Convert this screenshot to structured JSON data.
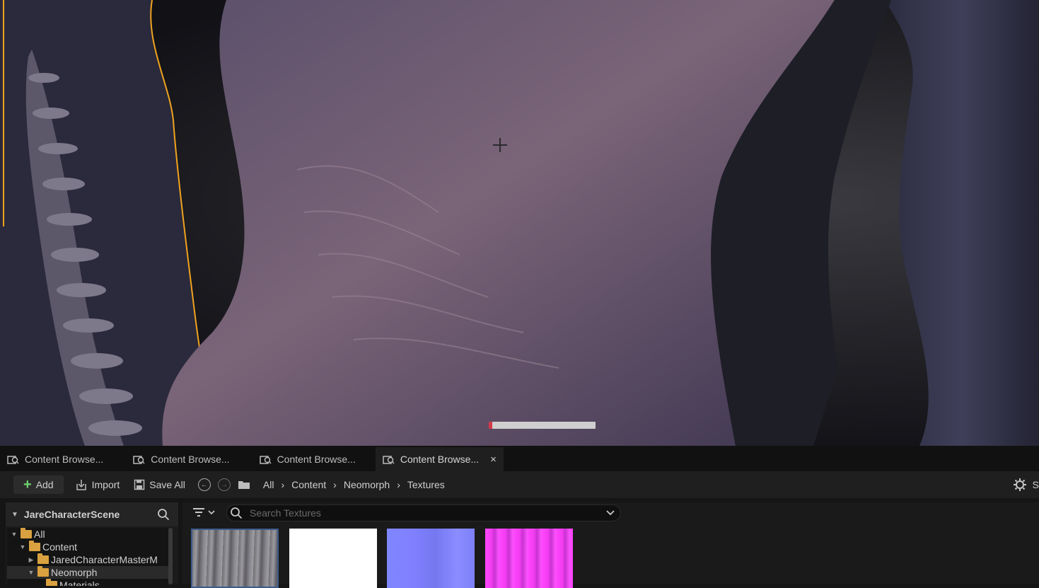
{
  "viewport": {
    "progress_fraction": 0.03,
    "selection_outline_color": "#f0a31e"
  },
  "tabs": [
    {
      "label": "Content Browse...",
      "icon": "content-browser-icon",
      "active": false
    },
    {
      "label": "Content Browse...",
      "icon": "content-browser-icon",
      "active": false
    },
    {
      "label": "Content Browse...",
      "icon": "content-browser-icon",
      "active": false
    },
    {
      "label": "Content Browse...",
      "icon": "content-browser-icon",
      "active": true,
      "close": "×"
    }
  ],
  "toolbar": {
    "add_label": "Add",
    "import_label": "Import",
    "save_all_label": "Save All",
    "breadcrumb": [
      "All",
      "Content",
      "Neomorph",
      "Textures"
    ],
    "settings_partial": "S"
  },
  "sources": {
    "title": "JareCharacterScene",
    "tree": [
      {
        "label": "All",
        "expanded": true
      },
      {
        "label": "Content",
        "expanded": true
      },
      {
        "label": "JaredCharacterMasterM",
        "expanded": false
      },
      {
        "label": "Neomorph",
        "expanded": true,
        "selected": true
      },
      {
        "label": "Materials",
        "expanded": false
      }
    ]
  },
  "assets": {
    "search_placeholder": "Search Textures",
    "thumbnails": [
      {
        "name": "texture-base-color",
        "color": "#8b8990"
      },
      {
        "name": "texture-white",
        "color": "#ffffff"
      },
      {
        "name": "texture-normal",
        "color": "#8080ff"
      },
      {
        "name": "texture-packed",
        "color": "#ff48ff"
      }
    ]
  },
  "colors": {
    "accent_add": "#6fd36f",
    "folder": "#d9a13f",
    "selection_border": "#3b5b8a"
  }
}
